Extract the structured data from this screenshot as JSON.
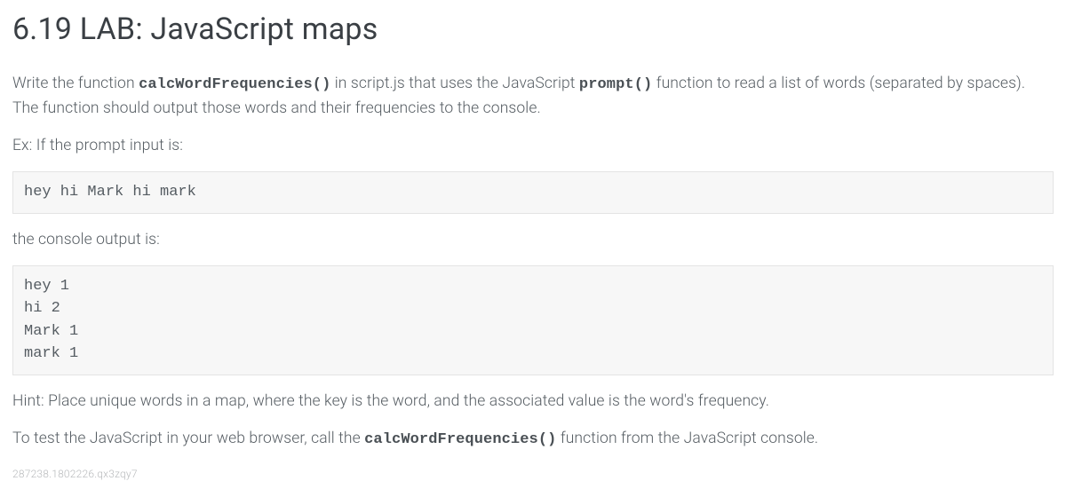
{
  "title": "6.19 LAB: JavaScript maps",
  "intro": {
    "pre1": "Write the function ",
    "code1": "calcWordFrequencies()",
    "mid1": " in script.js that uses the JavaScript ",
    "code2": "prompt()",
    "post1": " function to read a list of words (separated by spaces). The function should output those words and their frequencies to the console."
  },
  "example_label": "Ex: If the prompt input is:",
  "example_input": "hey hi Mark hi mark",
  "output_label": "the console output is:",
  "example_output": "hey 1\nhi 2\nMark 1\nmark 1",
  "hint": "Hint: Place unique words in a map, where the key is the word, and the associated value is the word's frequency.",
  "test_instruction": {
    "pre": "To test the JavaScript in your web browser, call the ",
    "code": "calcWordFrequencies()",
    "post": " function from the JavaScript console."
  },
  "footer_id": "287238.1802226.qx3zqy7"
}
